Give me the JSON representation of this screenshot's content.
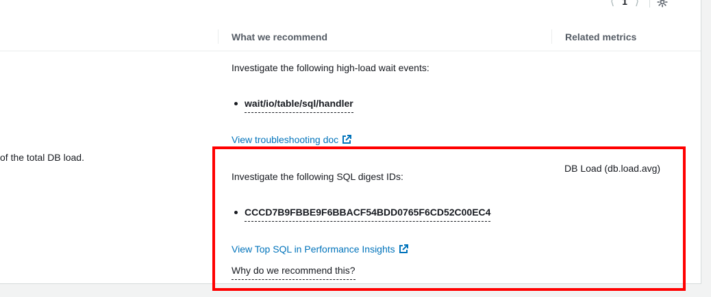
{
  "pagination": {
    "current_page": "1"
  },
  "table": {
    "columns": {
      "recommend": "What we recommend",
      "metrics": "Related metrics"
    }
  },
  "row": {
    "finding_fragment": "of the total DB load.",
    "wait_events": {
      "intro": "Investigate the following high-load wait events:",
      "item": "wait/io/table/sql/handler",
      "link": "View troubleshooting doc"
    },
    "sql_digests": {
      "intro": "Investigate the following SQL digest IDs:",
      "item": "CCCD7B9FBBE9F6BBACF54BDD0765F6CD52C00EC4",
      "link": "View Top SQL in Performance Insights",
      "why": "Why do we recommend this?"
    },
    "metric": "DB Load (db.load.avg)"
  },
  "colors": {
    "link": "#0073bb",
    "highlight": "#ff0000"
  },
  "icons": {
    "prev": "chevron-left-icon",
    "next": "chevron-right-icon",
    "settings": "gear-icon",
    "external": "external-link-icon"
  }
}
